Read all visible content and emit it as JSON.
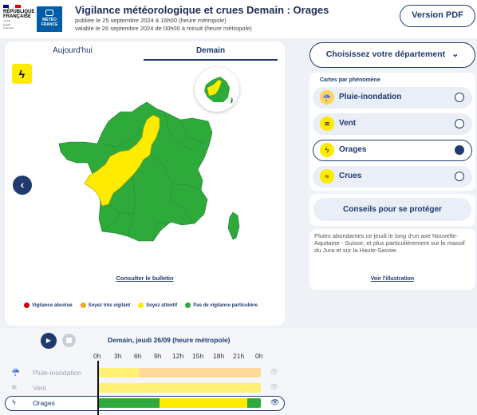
{
  "header": {
    "republique": [
      "RÉPUBLIQUE",
      "FRANÇAISE"
    ],
    "motto": [
      "Liberté",
      "Égalité",
      "Fraternité"
    ],
    "meteo_logo": [
      "MÉTÉO",
      "FRANCE"
    ],
    "title": "Vigilance météorologique et crues Demain : Orages",
    "published": "publiée le 25 septembre 2024 à 16h00 (heure métropole)",
    "valid": "valable le 26 septembre 2024 de 00h00 à minuit (heure métropole)",
    "pdf_button": "Version PDF"
  },
  "tabs": {
    "today": "Aujourd'hui",
    "tomorrow": "Demain",
    "selected": "tomorrow"
  },
  "map": {
    "bulletin_link": "Consulter le bulletin",
    "legend": [
      {
        "label": "Vigilance absolue",
        "color": "#d0021b"
      },
      {
        "label": "Soyez très vigilant",
        "color": "#f5a623"
      },
      {
        "label": "Soyez attentif",
        "color": "#ffeb00"
      },
      {
        "label": "Pas de vigilance particulière",
        "color": "#2eaa3b"
      }
    ]
  },
  "department_button": "Choisissez votre département",
  "phenomena": {
    "label": "Cartes par phénomène",
    "items": [
      {
        "name": "Pluie-inondation",
        "icon": "rain-flood-icon",
        "selected": false
      },
      {
        "name": "Vent",
        "icon": "wind-icon",
        "selected": false
      },
      {
        "name": "Orages",
        "icon": "lightning-icon",
        "selected": true
      },
      {
        "name": "Crues",
        "icon": "waves-icon",
        "selected": false
      }
    ]
  },
  "conseils_button": "Conseils pour se protéger",
  "description": {
    "text": "Pluies abondantes ce jeudi le long d'un axe Nouvelle-Aquitaine - Suisse, et plus particulièrement sur le massif du Jura et sur la Haute-Savoie.",
    "link": "Voir l'illustration"
  },
  "timeline": {
    "date": "Demain, jeudi 26/09 (heure métropole)",
    "hours": [
      "0h",
      "3h",
      "6h",
      "9h",
      "12h",
      "15h",
      "18h",
      "21h",
      "0h"
    ],
    "rows": [
      {
        "name": "Pluie-inondation",
        "segments": [
          {
            "hours": 6,
            "color": "#fff176"
          },
          {
            "hours": 18,
            "color": "#ffd89a"
          }
        ]
      },
      {
        "name": "Vent",
        "segments": [
          {
            "hours": 24,
            "color": "#fff176"
          }
        ]
      },
      {
        "name": "Orages",
        "segments": [
          {
            "hours": 9,
            "color": "#2eaa3b"
          },
          {
            "hours": 13,
            "color": "#ffeb00"
          },
          {
            "hours": 2,
            "color": "#2eaa3b"
          }
        ]
      }
    ]
  },
  "colors": {
    "accent": "#1e3a6e",
    "green": "#2eaa3b",
    "yellow": "#ffeb00"
  }
}
